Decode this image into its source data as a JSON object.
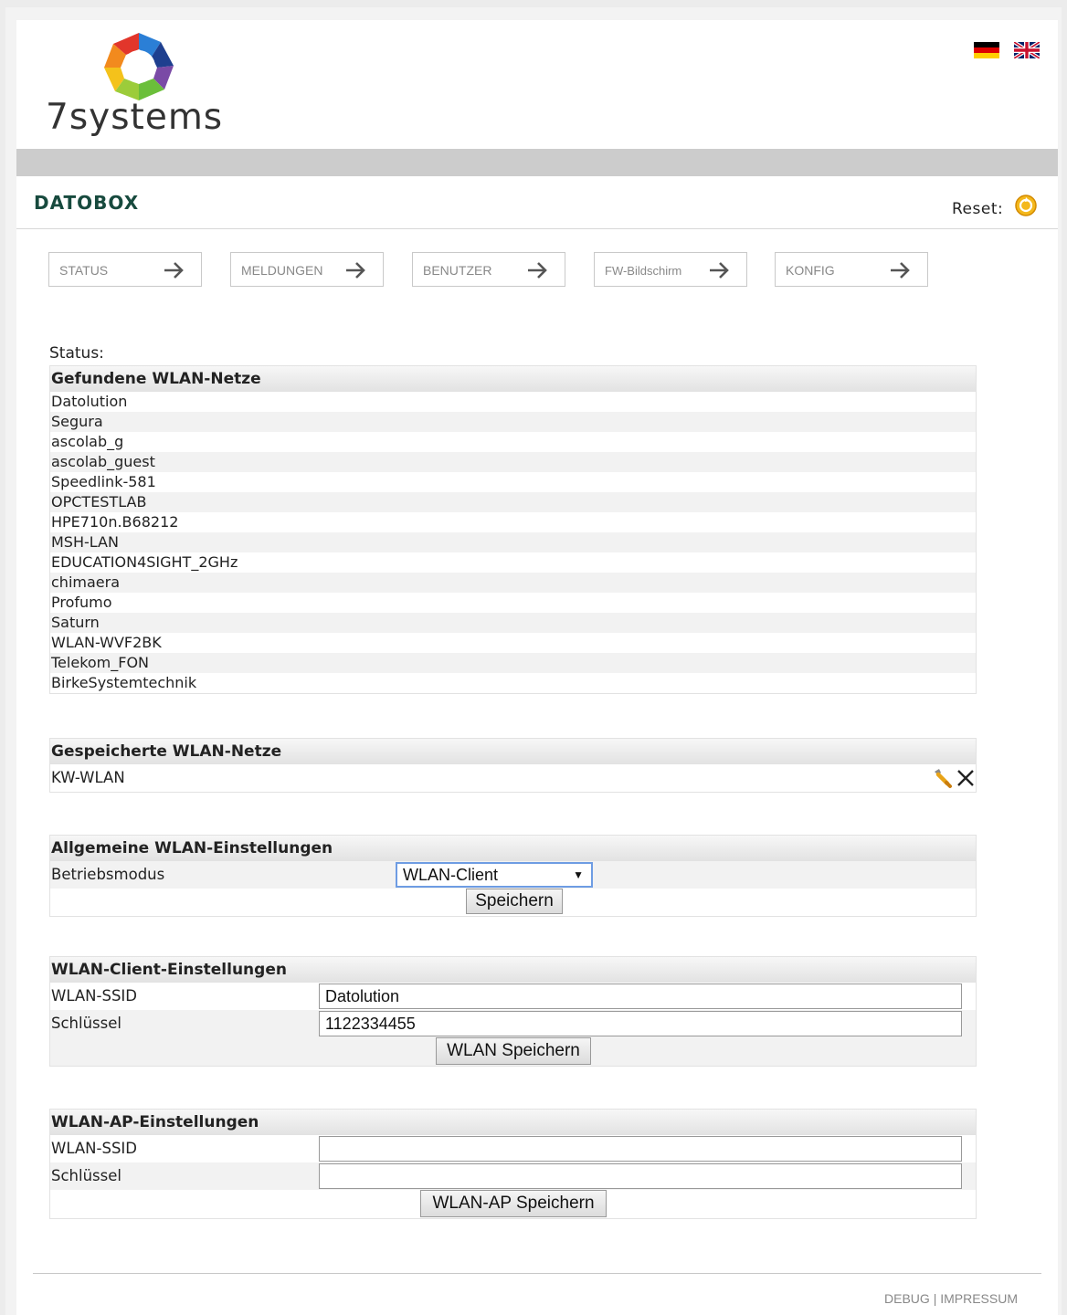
{
  "header": {
    "logo_text": "7systems",
    "title": "DATOBOX",
    "reset_label": "Reset:",
    "languages": [
      "de-flag-icon",
      "uk-flag-icon"
    ]
  },
  "nav": [
    {
      "label": "STATUS"
    },
    {
      "label": "MELDUNGEN"
    },
    {
      "label": "BENUTZER"
    },
    {
      "label": "FW-Bildschirm"
    },
    {
      "label": "KONFIG"
    }
  ],
  "status_label": "Status:",
  "found_networks": {
    "heading": "Gefundene WLAN-Netze",
    "items": [
      "Datolution",
      "Segura",
      "ascolab_g",
      "ascolab_guest",
      "Speedlink-581",
      "OPCTESTLAB",
      "HPE710n.B68212",
      "MSH-LAN",
      "EDUCATION4SIGHT_2GHz",
      "chimaera",
      "Profumo",
      "Saturn",
      "WLAN-WVF2BK",
      "Telekom_FON",
      "BirkeSystemtechnik"
    ]
  },
  "saved_networks": {
    "heading": "Gespeicherte WLAN-Netze",
    "items": [
      "KW-WLAN"
    ]
  },
  "general": {
    "heading": "Allgemeine WLAN-Einstellungen",
    "mode_label": "Betriebsmodus",
    "mode_value": "WLAN-Client",
    "save_label": "Speichern"
  },
  "client": {
    "heading": "WLAN-Client-Einstellungen",
    "ssid_label": "WLAN-SSID",
    "ssid_value": "Datolution",
    "key_label": "Schlüssel",
    "key_value": "1122334455",
    "save_label": "WLAN Speichern"
  },
  "ap": {
    "heading": "WLAN-AP-Einstellungen",
    "ssid_label": "WLAN-SSID",
    "ssid_value": "",
    "key_label": "Schlüssel",
    "key_value": "",
    "save_label": "WLAN-AP Speichern"
  },
  "footer": {
    "debug": "DEBUG",
    "separator": "|",
    "impressum": "IMPRESSUM"
  },
  "colors": {
    "title": "#174a3e",
    "gray_bar": "#cccccc"
  }
}
